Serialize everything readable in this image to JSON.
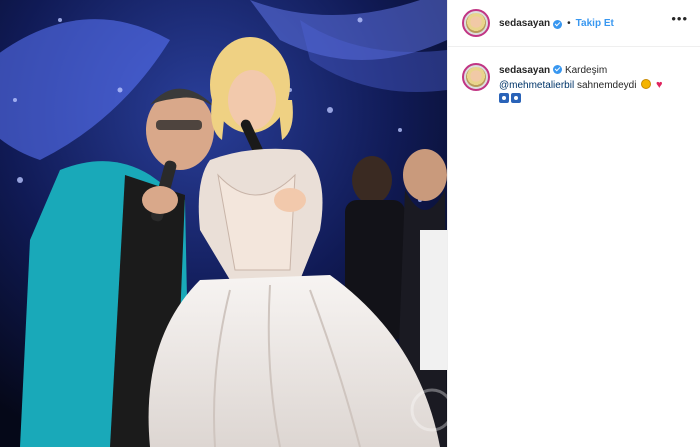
{
  "post": {
    "author": "sedasayan",
    "follow_label": "Takip Et",
    "separator": "•",
    "more_label": "•••",
    "caption": {
      "author": "sedasayan",
      "text": "Kardeşim",
      "mention": "@mehmetalierbil",
      "tail": "sahnemdeydi",
      "emojis": [
        "smiling-face-emoji",
        "heart-emoji",
        "eyes-emoji"
      ]
    }
  },
  "colors": {
    "link_blue": "#3897f0",
    "mention": "#003569",
    "heart": "#e0245e"
  }
}
